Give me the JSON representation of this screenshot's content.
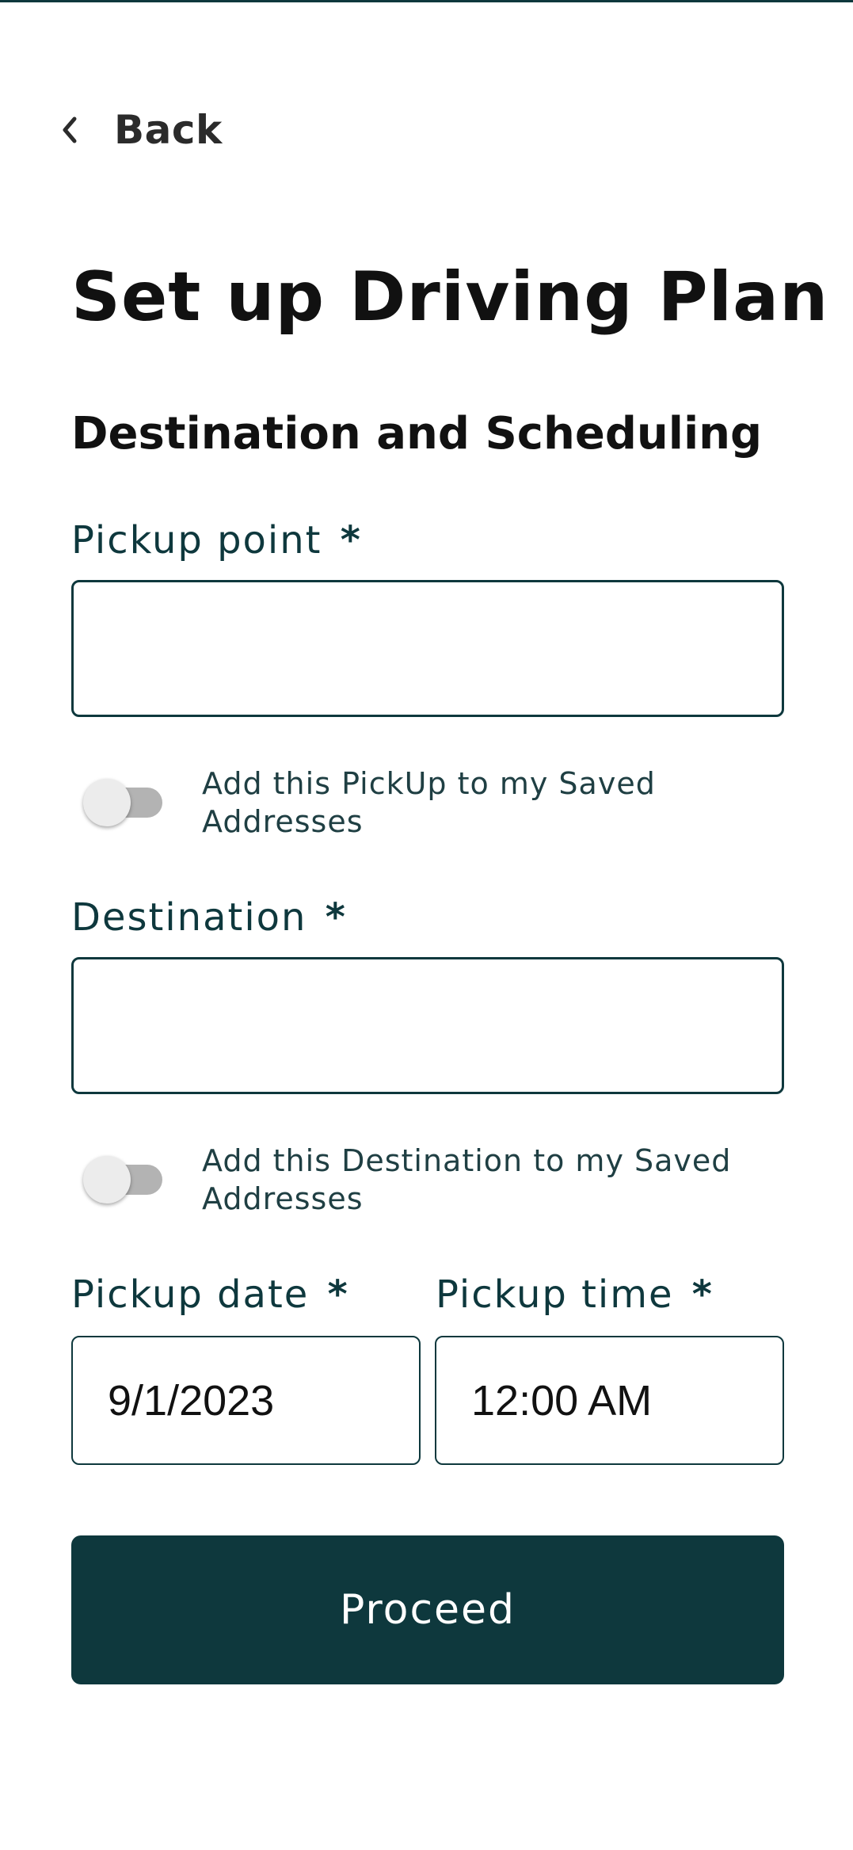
{
  "header": {
    "back_label": "Back"
  },
  "page": {
    "title": "Set up Driving Plan",
    "section_title": "Destination and Scheduling"
  },
  "form": {
    "required_marker": "*",
    "pickup": {
      "label": "Pickup point",
      "value": "",
      "save_toggle_label": "Add this PickUp to my Saved Addresses",
      "save_toggle_on": false
    },
    "destination": {
      "label": "Destination",
      "value": "",
      "save_toggle_label": "Add this Destination to my Saved Addresses",
      "save_toggle_on": false
    },
    "pickup_date": {
      "label": "Pickup date",
      "value": "9/1/2023"
    },
    "pickup_time": {
      "label": "Pickup time",
      "value": "12:00 AM"
    },
    "proceed_label": "Proceed"
  },
  "colors": {
    "primary": "#0e383d",
    "toggle_track_off": "#b3b3b3",
    "toggle_thumb_off": "#ececec"
  },
  "icons": {
    "back": "chevron-left-icon"
  }
}
